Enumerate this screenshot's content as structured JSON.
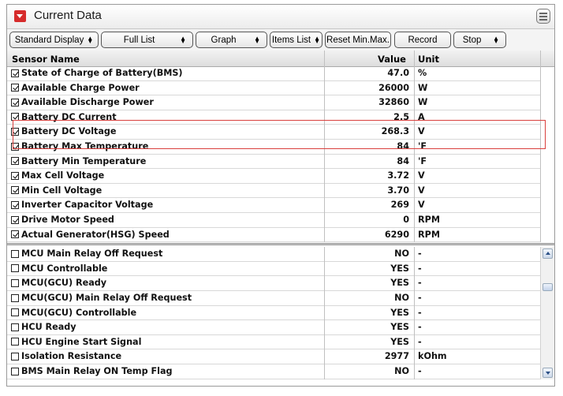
{
  "window": {
    "title": "Current Data"
  },
  "toolbar": {
    "display_mode": "Standard Display",
    "list_mode": "Full List",
    "graph": "Graph",
    "items_list": "Items List",
    "reset_minmax": "Reset Min.Max.",
    "record": "Record",
    "stop": "Stop"
  },
  "table": {
    "headers": {
      "name": "Sensor Name",
      "value": "Value",
      "unit": "Unit"
    },
    "highlight_color": "#d9403d",
    "selected_rows": [
      {
        "checked": true,
        "name": "State of Charge of Battery(BMS)",
        "value": "47.0",
        "unit": "%"
      },
      {
        "checked": true,
        "name": "Available Charge Power",
        "value": "26000",
        "unit": "W"
      },
      {
        "checked": true,
        "name": "Available Discharge Power",
        "value": "32860",
        "unit": "W"
      },
      {
        "checked": true,
        "name": "Battery DC Current",
        "value": "2.5",
        "unit": "A"
      },
      {
        "checked": true,
        "name": "Battery DC Voltage",
        "value": "268.3",
        "unit": "V"
      },
      {
        "checked": true,
        "name": "Battery Max Temperature",
        "value": "84",
        "unit": "'F"
      },
      {
        "checked": true,
        "name": "Battery Min Temperature",
        "value": "84",
        "unit": "'F"
      },
      {
        "checked": true,
        "name": "Max Cell Voltage",
        "value": "3.72",
        "unit": "V"
      },
      {
        "checked": true,
        "name": "Min Cell Voltage",
        "value": "3.70",
        "unit": "V"
      },
      {
        "checked": true,
        "name": "Inverter Capacitor Voltage",
        "value": "269",
        "unit": "V"
      },
      {
        "checked": true,
        "name": "Drive Motor Speed",
        "value": "0",
        "unit": "RPM"
      },
      {
        "checked": true,
        "name": "Actual Generator(HSG) Speed",
        "value": "6290",
        "unit": "RPM"
      }
    ],
    "other_rows": [
      {
        "checked": false,
        "name": "MCU Main Relay Off Request",
        "value": "NO",
        "unit": "-"
      },
      {
        "checked": false,
        "name": "MCU Controllable",
        "value": "YES",
        "unit": "-"
      },
      {
        "checked": false,
        "name": "MCU(GCU) Ready",
        "value": "YES",
        "unit": "-"
      },
      {
        "checked": false,
        "name": "MCU(GCU) Main Relay Off Request",
        "value": "NO",
        "unit": "-"
      },
      {
        "checked": false,
        "name": "MCU(GCU) Controllable",
        "value": "YES",
        "unit": "-"
      },
      {
        "checked": false,
        "name": "HCU Ready",
        "value": "YES",
        "unit": "-"
      },
      {
        "checked": false,
        "name": "HCU Engine Start Signal",
        "value": "YES",
        "unit": "-"
      },
      {
        "checked": false,
        "name": "Isolation Resistance",
        "value": "2977",
        "unit": "kOhm"
      },
      {
        "checked": false,
        "name": "BMS Main Relay ON Temp Flag",
        "value": "NO",
        "unit": "-"
      }
    ]
  }
}
